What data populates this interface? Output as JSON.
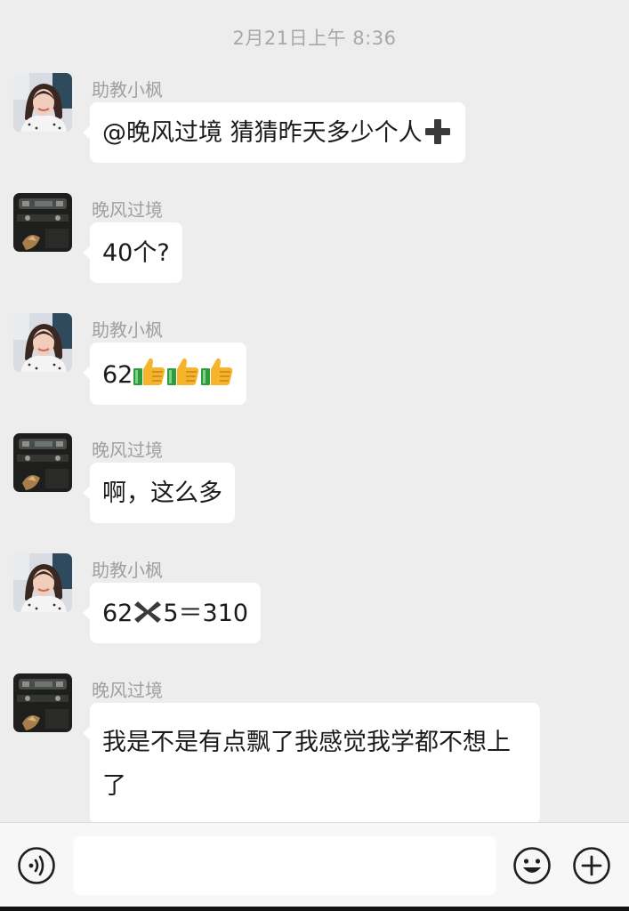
{
  "timestamp": "2月21日上午 8:36",
  "colors": {
    "background": "#ededed",
    "bubble": "#ffffff",
    "sender_name": "#a0a0a0",
    "timestamp": "#a8a8a8",
    "input_bar": "#f7f7f7"
  },
  "senders": {
    "teacher": "助教小枫",
    "student": "晚风过境"
  },
  "messages": [
    {
      "sender": "助教小枫",
      "avatar": "teacher-avatar",
      "text": "@晚风过境  猜猜昨天多少个人",
      "trailing_emoji": "heavy-plus-sign-icon"
    },
    {
      "sender": "晚风过境",
      "avatar": "student-avatar",
      "text": "40个?"
    },
    {
      "sender": "助教小枫",
      "avatar": "teacher-avatar",
      "text": "62",
      "trailing_emoji": "thumbs-up-icon ×3"
    },
    {
      "sender": "晚风过境",
      "avatar": "student-avatar",
      "text": "啊，这么多"
    },
    {
      "sender": "助教小枫",
      "avatar": "teacher-avatar",
      "text_before": "62",
      "inline_emoji": "heavy-multiplication-x-icon",
      "text_after": "5＝310"
    },
    {
      "sender": "晚风过境",
      "avatar": "student-avatar",
      "text": "我是不是有点飘了我感觉我学都不想上了"
    }
  ],
  "input_bar": {
    "left_icon": "voice-icon",
    "input_value": "",
    "right_icons": [
      "emoji-icon",
      "plus-icon"
    ]
  }
}
